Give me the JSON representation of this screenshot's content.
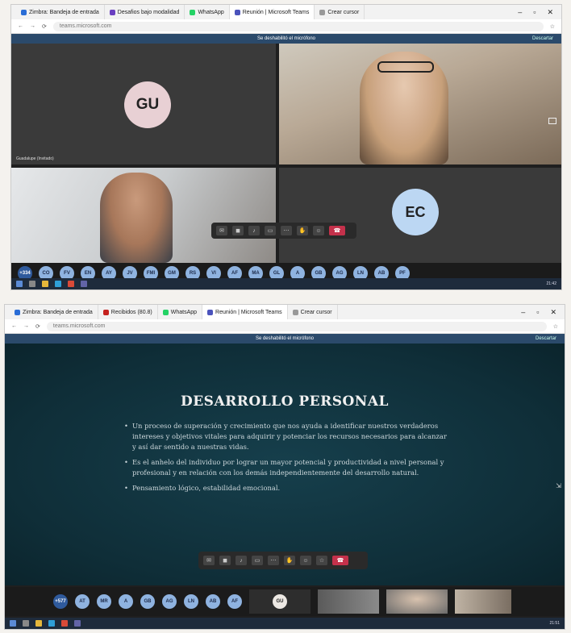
{
  "shot1": {
    "tabs": [
      {
        "label": "Zimbra: Bandeja de entrada",
        "color": "#2a6dd6"
      },
      {
        "label": "Desafios bajo modalidad",
        "color": "#6a3fc1"
      },
      {
        "label": "WhatsApp",
        "color": "#25d366"
      },
      {
        "label": "Reunión | Microsoft Teams",
        "color": "#4b53bc",
        "active": true
      },
      {
        "label": "Crear cursor",
        "color": "#999999"
      }
    ],
    "banner": {
      "text": "Se deshabilitó el micrófono",
      "right": "Descartar"
    },
    "tiles": [
      {
        "initials": "GU",
        "caption": "Guadalupe (Invitado)",
        "avatar_color": "#e8d0d4"
      },
      {
        "initials": "",
        "caption": "",
        "avatar_color": ""
      },
      {
        "initials": "",
        "caption": "",
        "avatar_color": ""
      },
      {
        "initials": "EC",
        "caption": "",
        "avatar_color": "#bcd7f3"
      }
    ],
    "participants": [
      "+334",
      "CO",
      "FV",
      "EN",
      "AY",
      "JV",
      "FMI",
      "GM",
      "RS",
      "VI",
      "AF",
      "MA",
      "GL",
      "A",
      "GB",
      "AG",
      "LN",
      "AB",
      "PF"
    ],
    "taskbar_clock": "21:42"
  },
  "shot2": {
    "tabs": [
      {
        "label": "Zimbra: Bandeja de entrada",
        "color": "#2a6dd6"
      },
      {
        "label": "Recibidos (80.8)",
        "color": "#c5221f"
      },
      {
        "label": "WhatsApp",
        "color": "#25d366"
      },
      {
        "label": "Reunión | Microsoft Teams",
        "color": "#4b53bc",
        "active": true
      },
      {
        "label": "Crear cursor",
        "color": "#999999"
      }
    ],
    "banner": {
      "text": "Se deshabilitó el micrófono",
      "right": "Descartar"
    },
    "slide": {
      "title": "DESARROLLO PERSONAL",
      "bullets": [
        "Un proceso de superación y crecimiento que nos ayuda a identificar nuestros verdaderos intereses y objetivos vitales para adquirir y potenciar los recursos necesarios para alcanzar y así dar sentido a nuestras vidas.",
        "Es el anhelo del individuo por lograr un mayor potencial y productividad a nivel personal y profesional y en relación con los demás independientemente del desarrollo natural.",
        "Pensamiento lógico, estabilidad emocional."
      ]
    },
    "participants": [
      "+577",
      "AT",
      "MR",
      "A",
      "GB",
      "AG",
      "LN",
      "AB",
      "AF"
    ],
    "self_tile": {
      "initials": "GU"
    },
    "taskbar_clock": "21:51"
  }
}
